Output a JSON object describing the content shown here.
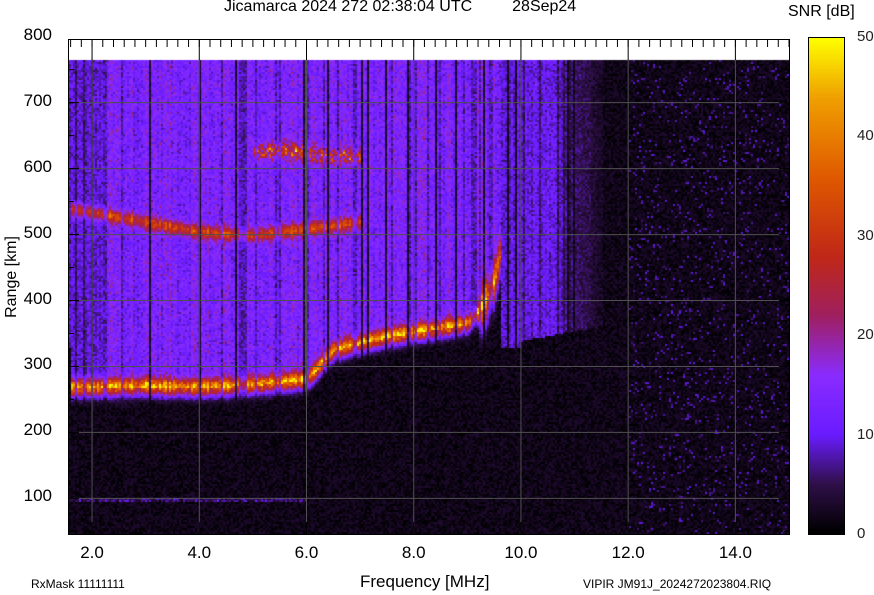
{
  "title": {
    "station": "Jicamarca 2024 272 02:38:04 UTC",
    "date": "28Sep24"
  },
  "footer": {
    "rxmask": "RxMask 11111111",
    "filename": "VIPIR  JM91J_2024272023804.RIQ"
  },
  "chart_data": {
    "type": "heatmap",
    "title": "Jicamarca 2024 272 02:38:04 UTC 28Sep24",
    "xlabel": "Frequency [MHz]",
    "ylabel": "Range [km]",
    "xlim": [
      1.57,
      15.0
    ],
    "ylim": [
      46,
      795
    ],
    "data_top_km": 765,
    "x_ticks": [
      "2.0",
      "4.0",
      "6.0",
      "8.0",
      "10.0",
      "12.0",
      "14.0"
    ],
    "x_tick_values": [
      2,
      4,
      6,
      8,
      10,
      12,
      14
    ],
    "y_ticks": [
      "800",
      "700",
      "600",
      "500",
      "400",
      "300",
      "200",
      "100"
    ],
    "y_tick_values": [
      800,
      700,
      600,
      500,
      400,
      300,
      200,
      100
    ],
    "grid": true,
    "colorbar": {
      "label": "SNR [dB]",
      "range": [
        0,
        50
      ],
      "ticks": [
        "50",
        "40",
        "30",
        "20",
        "10",
        "0"
      ],
      "tick_values": [
        50,
        40,
        30,
        20,
        10,
        0
      ],
      "stops": [
        [
          0,
          "#000000"
        ],
        [
          5,
          "#30104a"
        ],
        [
          10,
          "#6a1cff"
        ],
        [
          16,
          "#8a2cff"
        ],
        [
          22,
          "#a02060"
        ],
        [
          28,
          "#c02818"
        ],
        [
          36,
          "#e05a00"
        ],
        [
          44,
          "#f0a000"
        ],
        [
          50,
          "#ffff00"
        ]
      ]
    },
    "echo_traces": [
      {
        "name": "F-layer trace",
        "points": [
          [
            1.6,
            268
          ],
          [
            3.0,
            270
          ],
          [
            4.0,
            268
          ],
          [
            5.0,
            272
          ],
          [
            6.0,
            280
          ],
          [
            6.5,
            325
          ],
          [
            7.0,
            335
          ],
          [
            7.5,
            345
          ],
          [
            8.0,
            352
          ],
          [
            8.5,
            358
          ],
          [
            9.0,
            365
          ],
          [
            9.3,
            390
          ],
          [
            9.5,
            430
          ],
          [
            9.6,
            470
          ]
        ],
        "peak_snr": 32
      },
      {
        "name": "Second echo",
        "points": [
          [
            1.6,
            540
          ],
          [
            3.0,
            520
          ],
          [
            4.0,
            505
          ],
          [
            5.0,
            500
          ],
          [
            6.0,
            510
          ],
          [
            7.0,
            520
          ]
        ],
        "peak_snr": 18
      },
      {
        "name": "High echo",
        "points": [
          [
            5.0,
            625
          ],
          [
            5.5,
            630
          ],
          [
            6.5,
            620
          ],
          [
            7.0,
            620
          ]
        ],
        "peak_snr": 28
      }
    ],
    "spread_echo_max_freq_mhz": 11.5,
    "noise_floor_snr": 2
  }
}
